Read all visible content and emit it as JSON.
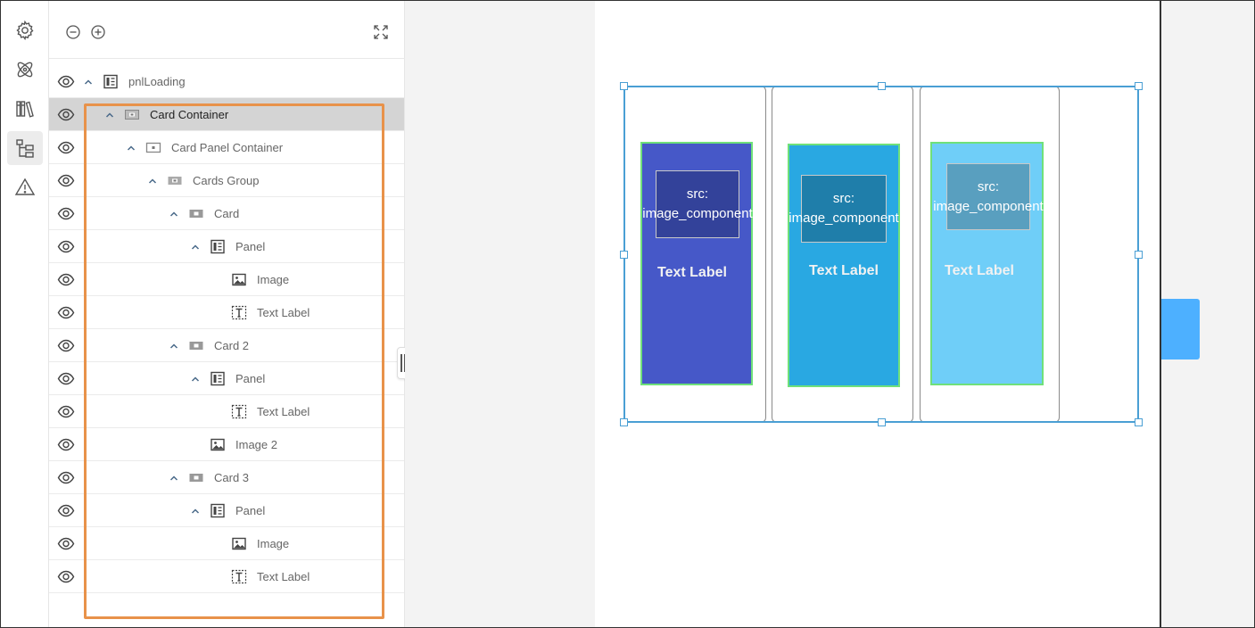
{
  "rail": {
    "items": [
      {
        "icon": "settings-gear-icon",
        "active": false
      },
      {
        "icon": "atom-icon",
        "active": false
      },
      {
        "icon": "library-books-icon",
        "active": false
      },
      {
        "icon": "layers-tree-icon",
        "active": true
      },
      {
        "icon": "warning-triangle-icon",
        "active": false
      }
    ]
  },
  "toolbar": {
    "collapse_icon": "minus-circle-icon",
    "expand_icon": "plus-circle-icon",
    "fullscreen_icon": "expand-arrows-icon"
  },
  "tree": {
    "items": [
      {
        "label": "pnlLoading",
        "icon": "panel-icon",
        "expanded": true,
        "selected": false
      },
      {
        "label": "Card Container",
        "icon": "container-icon",
        "expanded": true,
        "selected": true
      },
      {
        "label": "Card Panel Container",
        "icon": "container-outline-icon",
        "expanded": true,
        "selected": false
      },
      {
        "label": "Cards Group",
        "icon": "group-icon",
        "expanded": true,
        "selected": false
      },
      {
        "label": "Card",
        "icon": "card-icon",
        "expanded": true,
        "selected": false
      },
      {
        "label": "Panel",
        "icon": "panel-icon",
        "expanded": true,
        "selected": false
      },
      {
        "label": "Image",
        "icon": "image-icon",
        "expanded": null,
        "selected": false
      },
      {
        "label": "Text Label",
        "icon": "text-label-icon",
        "expanded": null,
        "selected": false
      },
      {
        "label": "Card 2",
        "icon": "card-icon",
        "expanded": true,
        "selected": false
      },
      {
        "label": "Panel",
        "icon": "panel-icon",
        "expanded": true,
        "selected": false
      },
      {
        "label": "Text Label",
        "icon": "text-label-icon",
        "expanded": null,
        "selected": false
      },
      {
        "label": "Image 2",
        "icon": "image-icon",
        "expanded": null,
        "selected": false
      },
      {
        "label": "Card 3",
        "icon": "card-icon",
        "expanded": true,
        "selected": false
      },
      {
        "label": "Panel",
        "icon": "panel-icon",
        "expanded": true,
        "selected": false
      },
      {
        "label": "Image",
        "icon": "image-icon",
        "expanded": null,
        "selected": false
      },
      {
        "label": "Text Label",
        "icon": "text-label-icon",
        "expanded": null,
        "selected": false
      }
    ]
  },
  "canvas": {
    "cards": [
      {
        "image_text": "src: image_component",
        "label": "Text Label",
        "panel_color": "#4658c8",
        "image_color": "#33429a"
      },
      {
        "image_text": "src: image_component",
        "label": "Text Label",
        "panel_color": "#29a8e2",
        "image_color": "#1f7eaa"
      },
      {
        "image_text": "src: image_component",
        "label": "Text Label",
        "panel_color": "#6fcef8",
        "image_color": "#599fbf"
      }
    ]
  },
  "colors": {
    "selection": "#4a9fd4",
    "annotation": "#e8924a",
    "panel_border": "#6fe07a",
    "side_tab": "#4db0ff"
  }
}
